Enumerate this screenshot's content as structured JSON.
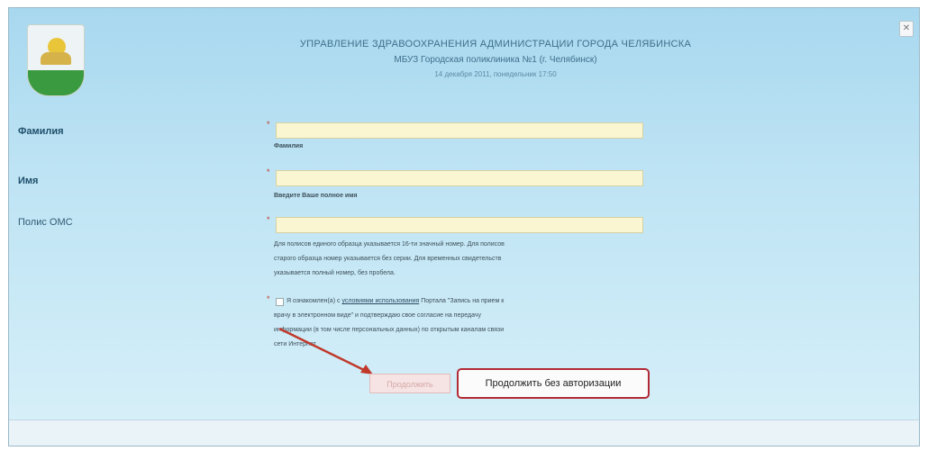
{
  "header": {
    "org": "УПРАВЛЕНИЕ ЗДРАВООХРАНЕНИЯ АДМИНИСТРАЦИИ ГОРОДА ЧЕЛЯБИНСКА",
    "clinic": "МБУЗ Городская поликлиника №1 (г. Челябинск)",
    "date": "14 декабря 2011, понедельник 17:50"
  },
  "form": {
    "surname": {
      "label": "Фамилия",
      "value": "",
      "hint": "Фамилия"
    },
    "name": {
      "label": "Имя",
      "value": "",
      "hint": "Введите Ваше полное имя"
    },
    "policy": {
      "label": "Полис ОМС",
      "value": "",
      "hint_lines": [
        "Для полисов единого образца указывается 16-ти значный номер. Для полисов",
        "старого образца номер указывается без серии. Для временных свидетельств",
        "указывается полный номер, без пробела."
      ]
    },
    "required_mark": "*",
    "agreement": {
      "prefix": "Я ознакомлен(а) с",
      "link": "условиями использования",
      "suffix": "Портала \"Запись на прием к",
      "lines": [
        "врачу в электронном виде\" и подтверждаю свое согласие на передачу",
        "информации (в том числе персональных данных) по открытым каналам связи",
        "сети Интернет"
      ],
      "checked": false
    }
  },
  "buttons": {
    "continue": "Продолжить",
    "continue_no_auth": "Продолжить без авторизации",
    "corner": "✕"
  },
  "colors": {
    "background_top": "#a8d8ef",
    "input_fill": "#faf6d2",
    "highlight_red": "#b22a35"
  }
}
